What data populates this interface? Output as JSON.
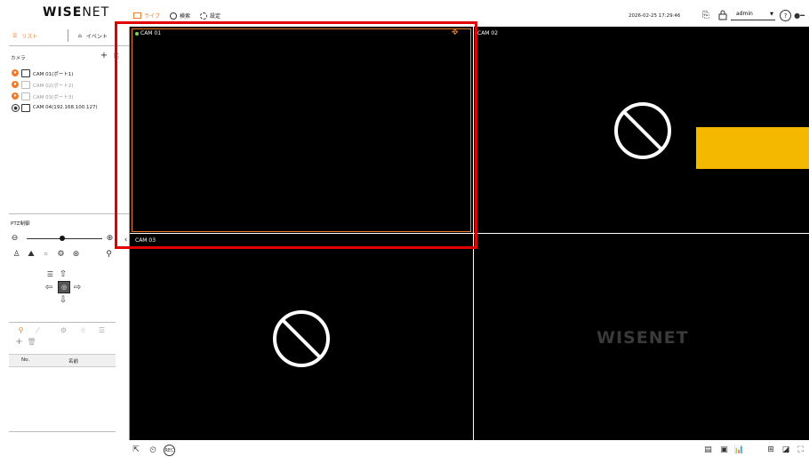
{
  "app": {
    "logo": "WISENET",
    "logo_dark": "WISE",
    "logo_light": "NET"
  },
  "topnav": [
    {
      "label": "ライブ",
      "icon": "monitor-icon",
      "active": true
    },
    {
      "label": "検索",
      "icon": "search-icon",
      "active": false
    },
    {
      "label": "設定",
      "icon": "gear-icon",
      "active": false
    }
  ],
  "header": {
    "datetime": "2026-02-25 17:29:46",
    "user": "admin"
  },
  "sidebar": {
    "tabs": [
      {
        "label": "リスト",
        "active": true
      },
      {
        "label": "イベント",
        "active": false
      }
    ],
    "camera_section": "カメラ",
    "cameras": [
      {
        "label": "CAM 01(ポート1)",
        "enabled": true
      },
      {
        "label": "CAM 02(ポート2)",
        "enabled": false
      },
      {
        "label": "CAM 03(ポート3)",
        "enabled": false
      },
      {
        "label": "CAM 04(192.168.100.127)",
        "enabled": true
      }
    ],
    "ptz_title": "PTZ制御",
    "preset_table": {
      "columns": [
        "No.",
        "名前"
      ]
    }
  },
  "tiles": [
    {
      "label": "CAM 01",
      "selected": true
    },
    {
      "label": "CAM 02",
      "selected": false
    },
    {
      "label": "CAM 03",
      "selected": false
    },
    {
      "label": "",
      "selected": false
    }
  ],
  "watermark": "WISENET",
  "colors": {
    "accent": "#f07c2a",
    "highlight_box": "#e00000",
    "yellow_tab": "#f5b800"
  }
}
